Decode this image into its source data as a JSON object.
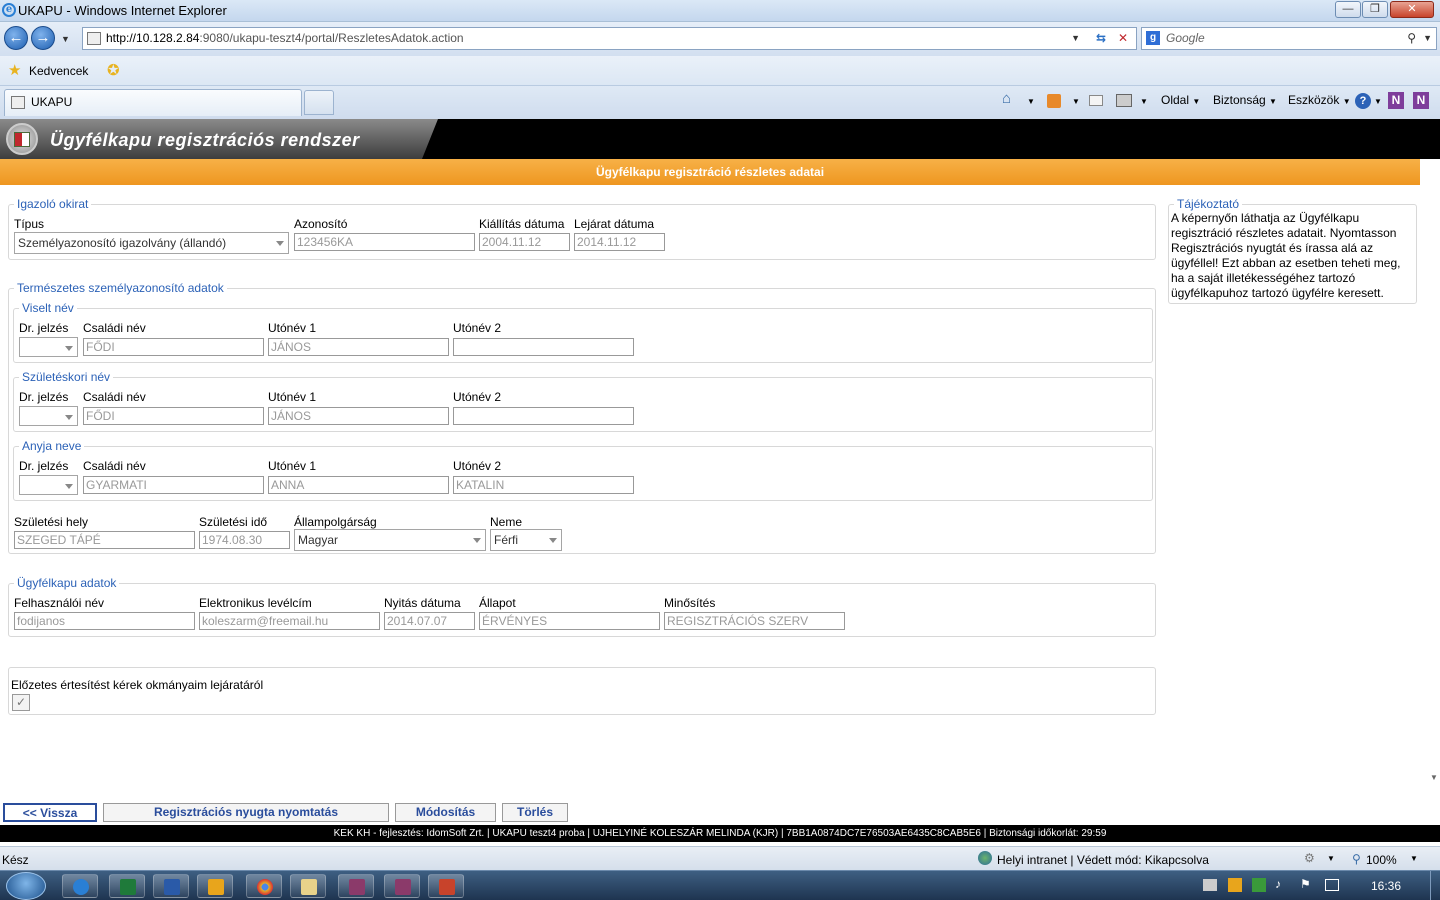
{
  "window": {
    "title": "UKAPU - Windows Internet Explorer"
  },
  "address": {
    "url_host": "http://10.128.2.84",
    "url_rest": ":9080/ukapu-teszt4/portal/ReszletesAdatok.action",
    "search_placeholder": "Google"
  },
  "favorites": {
    "label": "Kedvencek"
  },
  "tabs": [
    {
      "label": "UKAPU"
    }
  ],
  "commandbar": {
    "page": "Oldal",
    "safety": "Biztonság",
    "tools": "Eszközök"
  },
  "app": {
    "title": "Ügyfélkapu regisztrációs rendszer",
    "subtitle": "Ügyfélkapu regisztráció részletes adatai"
  },
  "igazolo": {
    "legend": "Igazoló okirat",
    "tipus_label": "Típus",
    "tipus_value": "Személyazonosító igazolvány (állandó)",
    "azonosito_label": "Azonosító",
    "azonosito_value": "123456KA",
    "kiallitas_label": "Kiállítás dátuma",
    "kiallitas_value": "2004.11.12",
    "lejarat_label": "Lejárat dátuma",
    "lejarat_value": "2014.11.12"
  },
  "termeszetes": {
    "legend": "Természetes személyazonosító adatok"
  },
  "labels": {
    "dr": "Dr. jelzés",
    "csaladi": "Családi név",
    "utonev1": "Utónév 1",
    "utonev2": "Utónév 2"
  },
  "viselt": {
    "legend": "Viselt név",
    "csaladi": "FŐDI",
    "utonev1": "JÁNOS",
    "utonev2": ""
  },
  "szuleteskori": {
    "legend": "Születéskori név",
    "csaladi": "FŐDI",
    "utonev1": "JÁNOS",
    "utonev2": ""
  },
  "anyja": {
    "legend": "Anyja neve",
    "csaladi": "GYARMATI",
    "utonev1": "ANNA",
    "utonev2": "KATALIN"
  },
  "szuletes": {
    "hely_label": "Születési hely",
    "hely_value": "SZEGED TÁPÉ",
    "ido_label": "Születési idő",
    "ido_value": "1974.08.30",
    "allampolgarsag_label": "Állampolgárság",
    "allampolgarsag_value": "Magyar",
    "neme_label": "Neme",
    "neme_value": "Férfi"
  },
  "ugyfelkapu": {
    "legend": "Ügyfélkapu adatok",
    "felhasznalo_label": "Felhasználói név",
    "felhasznalo_value": "fodijanos",
    "email_label": "Elektronikus levélcím",
    "email_value": "koleszarm@freemail.hu",
    "nyitas_label": "Nyitás dátuma",
    "nyitas_value": "2014.07.07",
    "allapot_label": "Állapot",
    "allapot_value": "ÉRVÉNYES",
    "minosites_label": "Minősítés",
    "minosites_value": "REGISZTRÁCIÓS SZERV"
  },
  "ertesites": {
    "label": "Előzetes értesítést kérek okmányaim lejáratáról",
    "checked": true
  },
  "tajekoztato": {
    "legend": "Tájékoztató",
    "text": "A képernyőn láthatja az Ügyfélkapu regisztráció részletes adatait. Nyomtasson Regisztrációs nyugtát és írassa alá az ügyféllel! Ezt abban az esetben teheti meg, ha a saját illetékességéhez tartozó ügyfélkapuhoz tartozó ügyfélre keresett."
  },
  "buttons": {
    "back": "<< Vissza",
    "print": "Regisztrációs nyugta nyomtatás",
    "modify": "Módosítás",
    "delete": "Törlés"
  },
  "footer": {
    "text": "KEK KH - fejlesztés: IdomSoft Zrt.  | UKAPU teszt4 proba  | UJHELYINÉ KOLESZÁR MELINDA  (KJR)  | 7BB1A0874DC7E76503AE6435C8CAB5E6 |  Biztonsági időkorlát:  29:59"
  },
  "status": {
    "left": "Kész",
    "zone": "Helyi intranet | Védett mód: Kikapcsolva",
    "zoom": "100%"
  },
  "taskbar": {
    "clock": "16:36"
  }
}
